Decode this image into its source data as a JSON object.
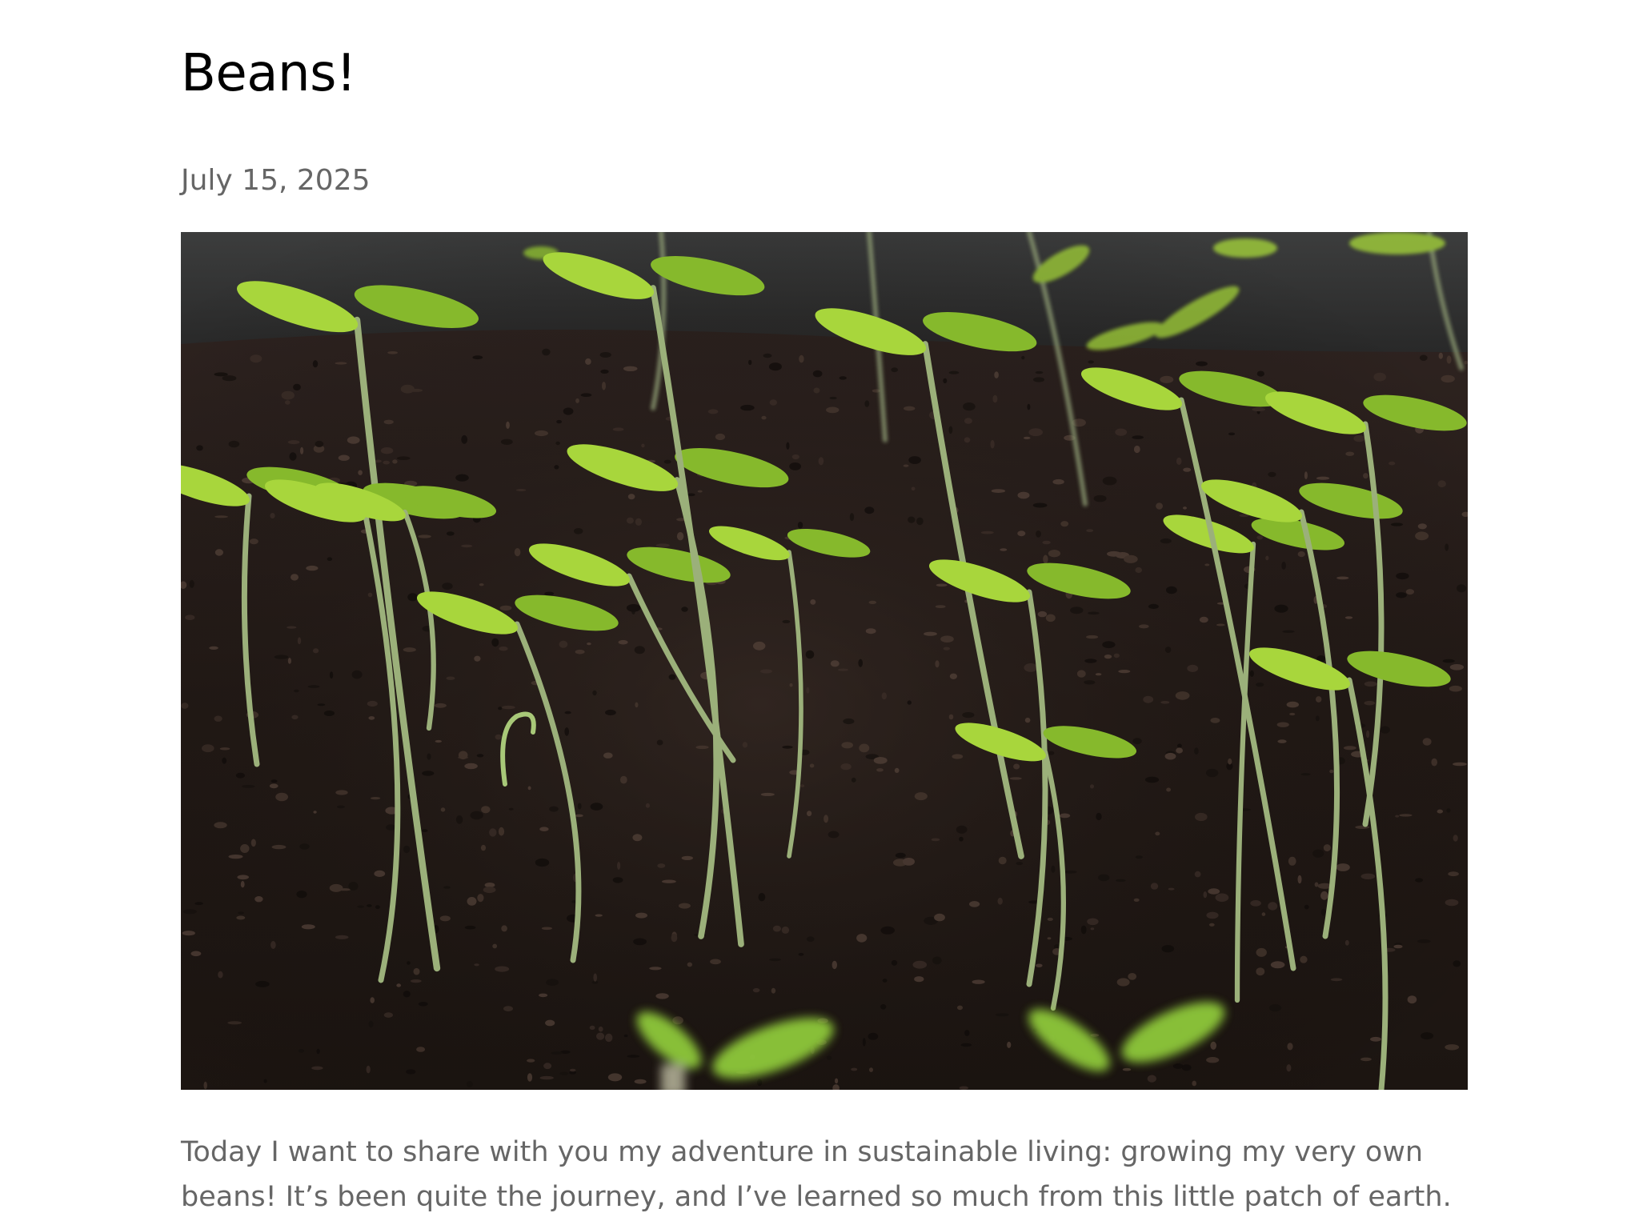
{
  "post": {
    "title": "Beans!",
    "date": "July 15, 2025",
    "body": "Today I want to share with you my adventure in sustainable living: growing my very own beans! It’s been quite the journey, and I’ve learned so much from this little patch of earth."
  },
  "colors": {
    "title": "#000000",
    "meta_text": "#666666",
    "soil": "#241c18",
    "seedling_leaf": "#a8d63c",
    "seedling_stem": "#9bb07a"
  }
}
